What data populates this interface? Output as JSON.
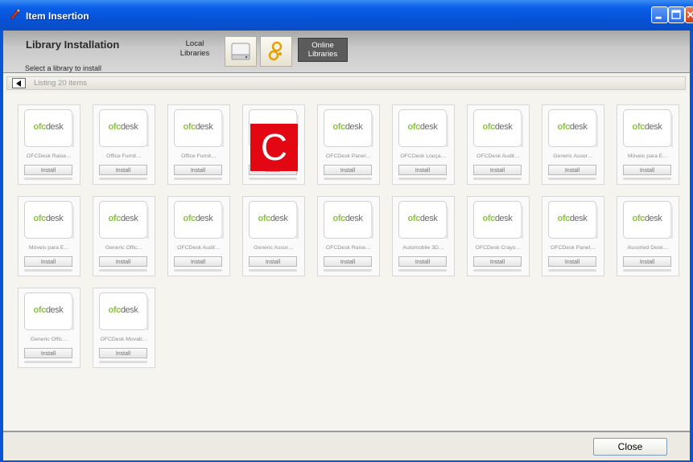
{
  "window": {
    "title": "Item Insertion",
    "accent": "#0a54d6",
    "buttons": [
      "minimize-icon",
      "maximize-icon",
      "close-icon"
    ]
  },
  "header": {
    "title": "Library Installation",
    "subtitle": "Select a library to install",
    "local_label_1": "Local",
    "local_label_2": "Libraries",
    "online_label_1": "Online",
    "online_label_2": "Libraries"
  },
  "listing": {
    "text": "Listing 20 items"
  },
  "marker": {
    "text": "C"
  },
  "items": [
    {
      "brand_a": "ofc",
      "brand_b": "desk",
      "name": "OFCDesk Raise…",
      "button": "Install"
    },
    {
      "brand_a": "ofc",
      "brand_b": "desk",
      "name": "Office Furnit…",
      "button": "Install"
    },
    {
      "brand_a": "ofc",
      "brand_b": "desk",
      "name": "Office Furnit…",
      "button": "Install"
    },
    {
      "brand_a": "",
      "brand_b": "",
      "name": "",
      "button": "Install"
    },
    {
      "brand_a": "ofc",
      "brand_b": "desk",
      "name": "OFCDesk Panel…",
      "button": "Install"
    },
    {
      "brand_a": "ofc",
      "brand_b": "desk",
      "name": "OFCDesk Louça…",
      "button": "Install"
    },
    {
      "brand_a": "ofc",
      "brand_b": "desk",
      "name": "OFCDesk Audit…",
      "button": "Install"
    },
    {
      "brand_a": "ofc",
      "brand_b": "desk",
      "name": "Generic Assor…",
      "button": "Install"
    },
    {
      "brand_a": "ofc",
      "brand_b": "desk",
      "name": "Móveis para E…",
      "button": "Install"
    },
    {
      "brand_a": "ofc",
      "brand_b": "desk",
      "name": "Móveis para E…",
      "button": "Install"
    },
    {
      "brand_a": "ofc",
      "brand_b": "desk",
      "name": "Generic Offic…",
      "button": "Install"
    },
    {
      "brand_a": "ofc",
      "brand_b": "desk",
      "name": "OFCDesk Audit…",
      "button": "Install"
    },
    {
      "brand_a": "ofc",
      "brand_b": "desk",
      "name": "Generic Assor…",
      "button": "Install"
    },
    {
      "brand_a": "ofc",
      "brand_b": "desk",
      "name": "OFCDesk Raise…",
      "button": "Install"
    },
    {
      "brand_a": "ofc",
      "brand_b": "desk",
      "name": "Automobile 3D…",
      "button": "Install"
    },
    {
      "brand_a": "ofc",
      "brand_b": "desk",
      "name": "OFCDesk Crayo…",
      "button": "Install"
    },
    {
      "brand_a": "ofc",
      "brand_b": "desk",
      "name": "OFCDesk Panel…",
      "button": "Install"
    },
    {
      "brand_a": "ofc",
      "brand_b": "desk",
      "name": "Assorted Desk…",
      "button": "Install"
    },
    {
      "brand_a": "ofc",
      "brand_b": "desk",
      "name": "Generic Offic…",
      "button": "Install"
    },
    {
      "brand_a": "ofc",
      "brand_b": "desk",
      "name": "OFCDesk Movab…",
      "button": "Install"
    }
  ],
  "footer": {
    "close_label": "Close"
  }
}
